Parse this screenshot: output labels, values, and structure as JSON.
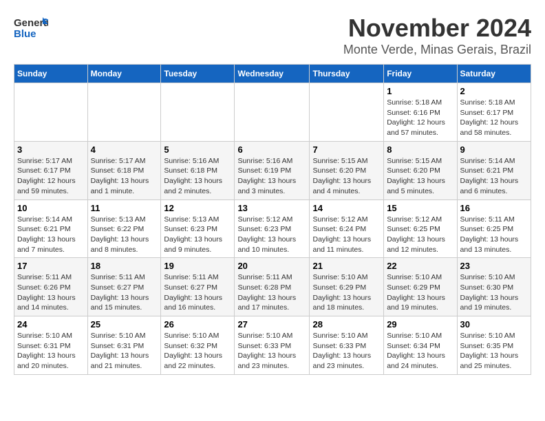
{
  "logo": {
    "text_general": "General",
    "text_blue": "Blue"
  },
  "title": "November 2024",
  "subtitle": "Monte Verde, Minas Gerais, Brazil",
  "weekdays": [
    "Sunday",
    "Monday",
    "Tuesday",
    "Wednesday",
    "Thursday",
    "Friday",
    "Saturday"
  ],
  "weeks": [
    [
      {
        "day": "",
        "info": ""
      },
      {
        "day": "",
        "info": ""
      },
      {
        "day": "",
        "info": ""
      },
      {
        "day": "",
        "info": ""
      },
      {
        "day": "",
        "info": ""
      },
      {
        "day": "1",
        "info": "Sunrise: 5:18 AM\nSunset: 6:16 PM\nDaylight: 12 hours and 57 minutes."
      },
      {
        "day": "2",
        "info": "Sunrise: 5:18 AM\nSunset: 6:17 PM\nDaylight: 12 hours and 58 minutes."
      }
    ],
    [
      {
        "day": "3",
        "info": "Sunrise: 5:17 AM\nSunset: 6:17 PM\nDaylight: 12 hours and 59 minutes."
      },
      {
        "day": "4",
        "info": "Sunrise: 5:17 AM\nSunset: 6:18 PM\nDaylight: 13 hours and 1 minute."
      },
      {
        "day": "5",
        "info": "Sunrise: 5:16 AM\nSunset: 6:18 PM\nDaylight: 13 hours and 2 minutes."
      },
      {
        "day": "6",
        "info": "Sunrise: 5:16 AM\nSunset: 6:19 PM\nDaylight: 13 hours and 3 minutes."
      },
      {
        "day": "7",
        "info": "Sunrise: 5:15 AM\nSunset: 6:20 PM\nDaylight: 13 hours and 4 minutes."
      },
      {
        "day": "8",
        "info": "Sunrise: 5:15 AM\nSunset: 6:20 PM\nDaylight: 13 hours and 5 minutes."
      },
      {
        "day": "9",
        "info": "Sunrise: 5:14 AM\nSunset: 6:21 PM\nDaylight: 13 hours and 6 minutes."
      }
    ],
    [
      {
        "day": "10",
        "info": "Sunrise: 5:14 AM\nSunset: 6:21 PM\nDaylight: 13 hours and 7 minutes."
      },
      {
        "day": "11",
        "info": "Sunrise: 5:13 AM\nSunset: 6:22 PM\nDaylight: 13 hours and 8 minutes."
      },
      {
        "day": "12",
        "info": "Sunrise: 5:13 AM\nSunset: 6:23 PM\nDaylight: 13 hours and 9 minutes."
      },
      {
        "day": "13",
        "info": "Sunrise: 5:12 AM\nSunset: 6:23 PM\nDaylight: 13 hours and 10 minutes."
      },
      {
        "day": "14",
        "info": "Sunrise: 5:12 AM\nSunset: 6:24 PM\nDaylight: 13 hours and 11 minutes."
      },
      {
        "day": "15",
        "info": "Sunrise: 5:12 AM\nSunset: 6:25 PM\nDaylight: 13 hours and 12 minutes."
      },
      {
        "day": "16",
        "info": "Sunrise: 5:11 AM\nSunset: 6:25 PM\nDaylight: 13 hours and 13 minutes."
      }
    ],
    [
      {
        "day": "17",
        "info": "Sunrise: 5:11 AM\nSunset: 6:26 PM\nDaylight: 13 hours and 14 minutes."
      },
      {
        "day": "18",
        "info": "Sunrise: 5:11 AM\nSunset: 6:27 PM\nDaylight: 13 hours and 15 minutes."
      },
      {
        "day": "19",
        "info": "Sunrise: 5:11 AM\nSunset: 6:27 PM\nDaylight: 13 hours and 16 minutes."
      },
      {
        "day": "20",
        "info": "Sunrise: 5:11 AM\nSunset: 6:28 PM\nDaylight: 13 hours and 17 minutes."
      },
      {
        "day": "21",
        "info": "Sunrise: 5:10 AM\nSunset: 6:29 PM\nDaylight: 13 hours and 18 minutes."
      },
      {
        "day": "22",
        "info": "Sunrise: 5:10 AM\nSunset: 6:29 PM\nDaylight: 13 hours and 19 minutes."
      },
      {
        "day": "23",
        "info": "Sunrise: 5:10 AM\nSunset: 6:30 PM\nDaylight: 13 hours and 19 minutes."
      }
    ],
    [
      {
        "day": "24",
        "info": "Sunrise: 5:10 AM\nSunset: 6:31 PM\nDaylight: 13 hours and 20 minutes."
      },
      {
        "day": "25",
        "info": "Sunrise: 5:10 AM\nSunset: 6:31 PM\nDaylight: 13 hours and 21 minutes."
      },
      {
        "day": "26",
        "info": "Sunrise: 5:10 AM\nSunset: 6:32 PM\nDaylight: 13 hours and 22 minutes."
      },
      {
        "day": "27",
        "info": "Sunrise: 5:10 AM\nSunset: 6:33 PM\nDaylight: 13 hours and 23 minutes."
      },
      {
        "day": "28",
        "info": "Sunrise: 5:10 AM\nSunset: 6:33 PM\nDaylight: 13 hours and 23 minutes."
      },
      {
        "day": "29",
        "info": "Sunrise: 5:10 AM\nSunset: 6:34 PM\nDaylight: 13 hours and 24 minutes."
      },
      {
        "day": "30",
        "info": "Sunrise: 5:10 AM\nSunset: 6:35 PM\nDaylight: 13 hours and 25 minutes."
      }
    ]
  ]
}
